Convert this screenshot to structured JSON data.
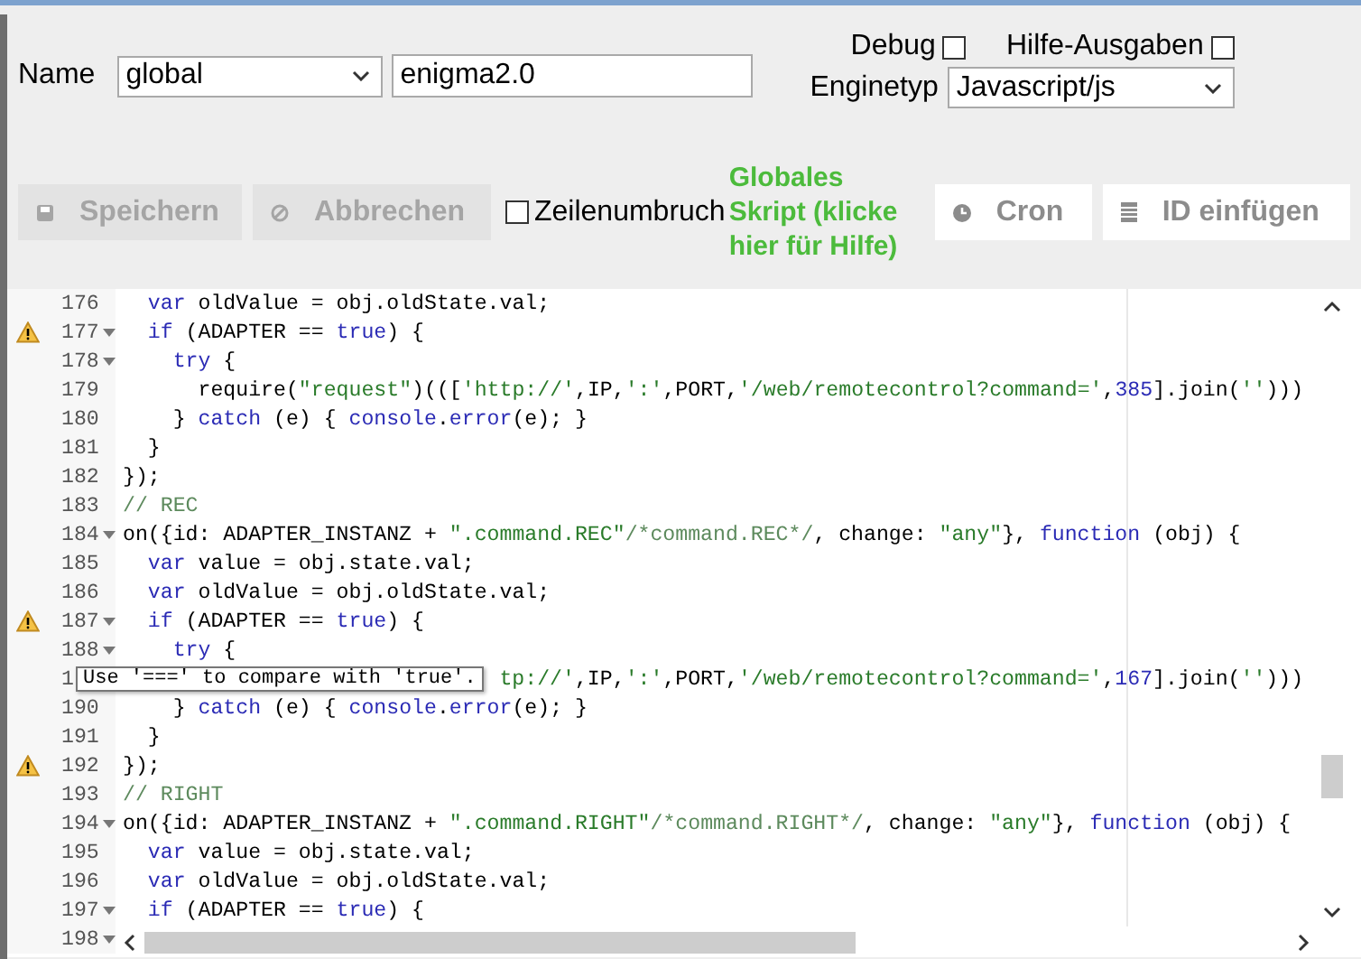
{
  "header": {
    "name_label": "Name",
    "scope_select": {
      "value": "global"
    },
    "name_field": {
      "value": "enigma2.0"
    },
    "debug": {
      "label": "Debug",
      "checked": false
    },
    "help_output": {
      "label": "Hilfe-Ausgaben",
      "checked": false
    },
    "engine_label": "Enginetyp",
    "engine_select": {
      "value": "Javascript/js"
    }
  },
  "toolbar": {
    "items": [
      {
        "kind": "button",
        "label": "Speichern",
        "disabled": true
      },
      {
        "kind": "button",
        "label": "Abbrechen",
        "disabled": true
      },
      {
        "kind": "checkbox",
        "label": "Zeilenumbruch",
        "checked": false
      },
      {
        "kind": "note",
        "label": "Globales Skript (klicke hier für Hilfe)"
      },
      {
        "kind": "button",
        "label": "Cron",
        "disabled": false
      },
      {
        "kind": "button",
        "label": "ID einfügen",
        "disabled": false
      }
    ]
  },
  "editor": {
    "lines": [
      {
        "number": "176",
        "fold": false,
        "warning": false,
        "segments": [
          {
            "kind": "keyword",
            "text": "  var"
          },
          {
            "kind": "plain",
            "text": " oldValue = obj.oldState.val;"
          }
        ]
      },
      {
        "number": "177",
        "fold": true,
        "warning": true,
        "segments": [
          {
            "kind": "keyword",
            "text": "  if"
          },
          {
            "kind": "plain",
            "text": " (ADAPTER == "
          },
          {
            "kind": "atom",
            "text": "true"
          },
          {
            "kind": "plain",
            "text": ") {"
          }
        ]
      },
      {
        "number": "178",
        "fold": true,
        "warning": false,
        "segments": [
          {
            "kind": "keyword",
            "text": "    try"
          },
          {
            "kind": "plain",
            "text": " {"
          }
        ]
      },
      {
        "number": "179",
        "fold": false,
        "warning": false,
        "segments": [
          {
            "kind": "plain",
            "text": "      require("
          },
          {
            "kind": "string",
            "text": "\"request\""
          },
          {
            "kind": "plain",
            "text": ")((["
          },
          {
            "kind": "string",
            "text": "'http://'"
          },
          {
            "kind": "plain",
            "text": ",IP,"
          },
          {
            "kind": "string",
            "text": "':'"
          },
          {
            "kind": "plain",
            "text": ",PORT,"
          },
          {
            "kind": "string",
            "text": "'/web/remotecontrol?command='"
          },
          {
            "kind": "plain",
            "text": ","
          },
          {
            "kind": "number",
            "text": "385"
          },
          {
            "kind": "plain",
            "text": "].join("
          },
          {
            "kind": "string",
            "text": "''"
          },
          {
            "kind": "plain",
            "text": ")))"
          }
        ]
      },
      {
        "number": "180",
        "fold": false,
        "warning": false,
        "segments": [
          {
            "kind": "plain",
            "text": "    } "
          },
          {
            "kind": "keyword",
            "text": "catch"
          },
          {
            "kind": "plain",
            "text": " (e) { "
          },
          {
            "kind": "builtin",
            "text": "console"
          },
          {
            "kind": "plain",
            "text": "."
          },
          {
            "kind": "builtin",
            "text": "error"
          },
          {
            "kind": "plain",
            "text": "(e); }"
          }
        ]
      },
      {
        "number": "181",
        "fold": false,
        "warning": false,
        "segments": [
          {
            "kind": "plain",
            "text": "  }"
          }
        ]
      },
      {
        "number": "182",
        "fold": false,
        "warning": false,
        "segments": [
          {
            "kind": "plain",
            "text": "});"
          }
        ]
      },
      {
        "number": "183",
        "fold": false,
        "warning": false,
        "segments": [
          {
            "kind": "comment",
            "text": "// REC"
          }
        ]
      },
      {
        "number": "184",
        "fold": true,
        "warning": false,
        "segments": [
          {
            "kind": "plain",
            "text": "on({id: ADAPTER_INSTANZ + "
          },
          {
            "kind": "string",
            "text": "\".command.REC\""
          },
          {
            "kind": "comment",
            "text": "/*command.REC*/"
          },
          {
            "kind": "plain",
            "text": ", change: "
          },
          {
            "kind": "string",
            "text": "\"any\""
          },
          {
            "kind": "plain",
            "text": "}, "
          },
          {
            "kind": "keyword",
            "text": "function"
          },
          {
            "kind": "plain",
            "text": " (obj) {"
          }
        ]
      },
      {
        "number": "185",
        "fold": false,
        "warning": false,
        "segments": [
          {
            "kind": "keyword",
            "text": "  var"
          },
          {
            "kind": "plain",
            "text": " value = obj.state.val;"
          }
        ]
      },
      {
        "number": "186",
        "fold": false,
        "warning": false,
        "segments": [
          {
            "kind": "keyword",
            "text": "  var"
          },
          {
            "kind": "plain",
            "text": " oldValue = obj.oldState.val;"
          }
        ]
      },
      {
        "number": "187",
        "fold": true,
        "warning": true,
        "segments": [
          {
            "kind": "keyword",
            "text": "  if"
          },
          {
            "kind": "plain",
            "text": " (ADAPTER == "
          },
          {
            "kind": "atom",
            "text": "true"
          },
          {
            "kind": "plain",
            "text": ") {"
          }
        ]
      },
      {
        "number": "188",
        "fold": true,
        "warning": false,
        "segments": [
          {
            "kind": "keyword",
            "text": "    try"
          },
          {
            "kind": "plain",
            "text": " {"
          }
        ]
      },
      {
        "number": "1",
        "fold": false,
        "warning": false,
        "tooltip": "Use '===' to compare with 'true'.",
        "segments": [
          {
            "kind": "string",
            "text": "tp://'"
          },
          {
            "kind": "plain",
            "text": ",IP,"
          },
          {
            "kind": "string",
            "text": "':'"
          },
          {
            "kind": "plain",
            "text": ",PORT,"
          },
          {
            "kind": "string",
            "text": "'/web/remotecontrol?command='"
          },
          {
            "kind": "plain",
            "text": ","
          },
          {
            "kind": "number",
            "text": "167"
          },
          {
            "kind": "plain",
            "text": "].join("
          },
          {
            "kind": "string",
            "text": "''"
          },
          {
            "kind": "plain",
            "text": ")))"
          }
        ]
      },
      {
        "number": "190",
        "fold": false,
        "warning": false,
        "segments": [
          {
            "kind": "plain",
            "text": "    } "
          },
          {
            "kind": "keyword",
            "text": "catch"
          },
          {
            "kind": "plain",
            "text": " (e) { "
          },
          {
            "kind": "builtin",
            "text": "console"
          },
          {
            "kind": "plain",
            "text": "."
          },
          {
            "kind": "builtin",
            "text": "error"
          },
          {
            "kind": "plain",
            "text": "(e); }"
          }
        ]
      },
      {
        "number": "191",
        "fold": false,
        "warning": false,
        "segments": [
          {
            "kind": "plain",
            "text": "  }"
          }
        ]
      },
      {
        "number": "192",
        "fold": false,
        "warning": true,
        "segments": [
          {
            "kind": "plain",
            "text": "});"
          }
        ]
      },
      {
        "number": "193",
        "fold": false,
        "warning": false,
        "segments": [
          {
            "kind": "comment",
            "text": "// RIGHT"
          }
        ]
      },
      {
        "number": "194",
        "fold": true,
        "warning": false,
        "segments": [
          {
            "kind": "plain",
            "text": "on({id: ADAPTER_INSTANZ + "
          },
          {
            "kind": "string",
            "text": "\".command.RIGHT\""
          },
          {
            "kind": "comment",
            "text": "/*command.RIGHT*/"
          },
          {
            "kind": "plain",
            "text": ", change: "
          },
          {
            "kind": "string",
            "text": "\"any\""
          },
          {
            "kind": "plain",
            "text": "}, "
          },
          {
            "kind": "keyword",
            "text": "function"
          },
          {
            "kind": "plain",
            "text": " (obj) {"
          }
        ]
      },
      {
        "number": "195",
        "fold": false,
        "warning": false,
        "segments": [
          {
            "kind": "keyword",
            "text": "  var"
          },
          {
            "kind": "plain",
            "text": " value = obj.state.val;"
          }
        ]
      },
      {
        "number": "196",
        "fold": false,
        "warning": false,
        "segments": [
          {
            "kind": "keyword",
            "text": "  var"
          },
          {
            "kind": "plain",
            "text": " oldValue = obj.oldState.val;"
          }
        ]
      },
      {
        "number": "197",
        "fold": true,
        "warning": false,
        "segments": [
          {
            "kind": "keyword",
            "text": "  if"
          },
          {
            "kind": "plain",
            "text": " (ADAPTER == "
          },
          {
            "kind": "atom",
            "text": "true"
          },
          {
            "kind": "plain",
            "text": ") {"
          }
        ]
      },
      {
        "number": "198",
        "fold": true,
        "warning": false
      }
    ]
  }
}
